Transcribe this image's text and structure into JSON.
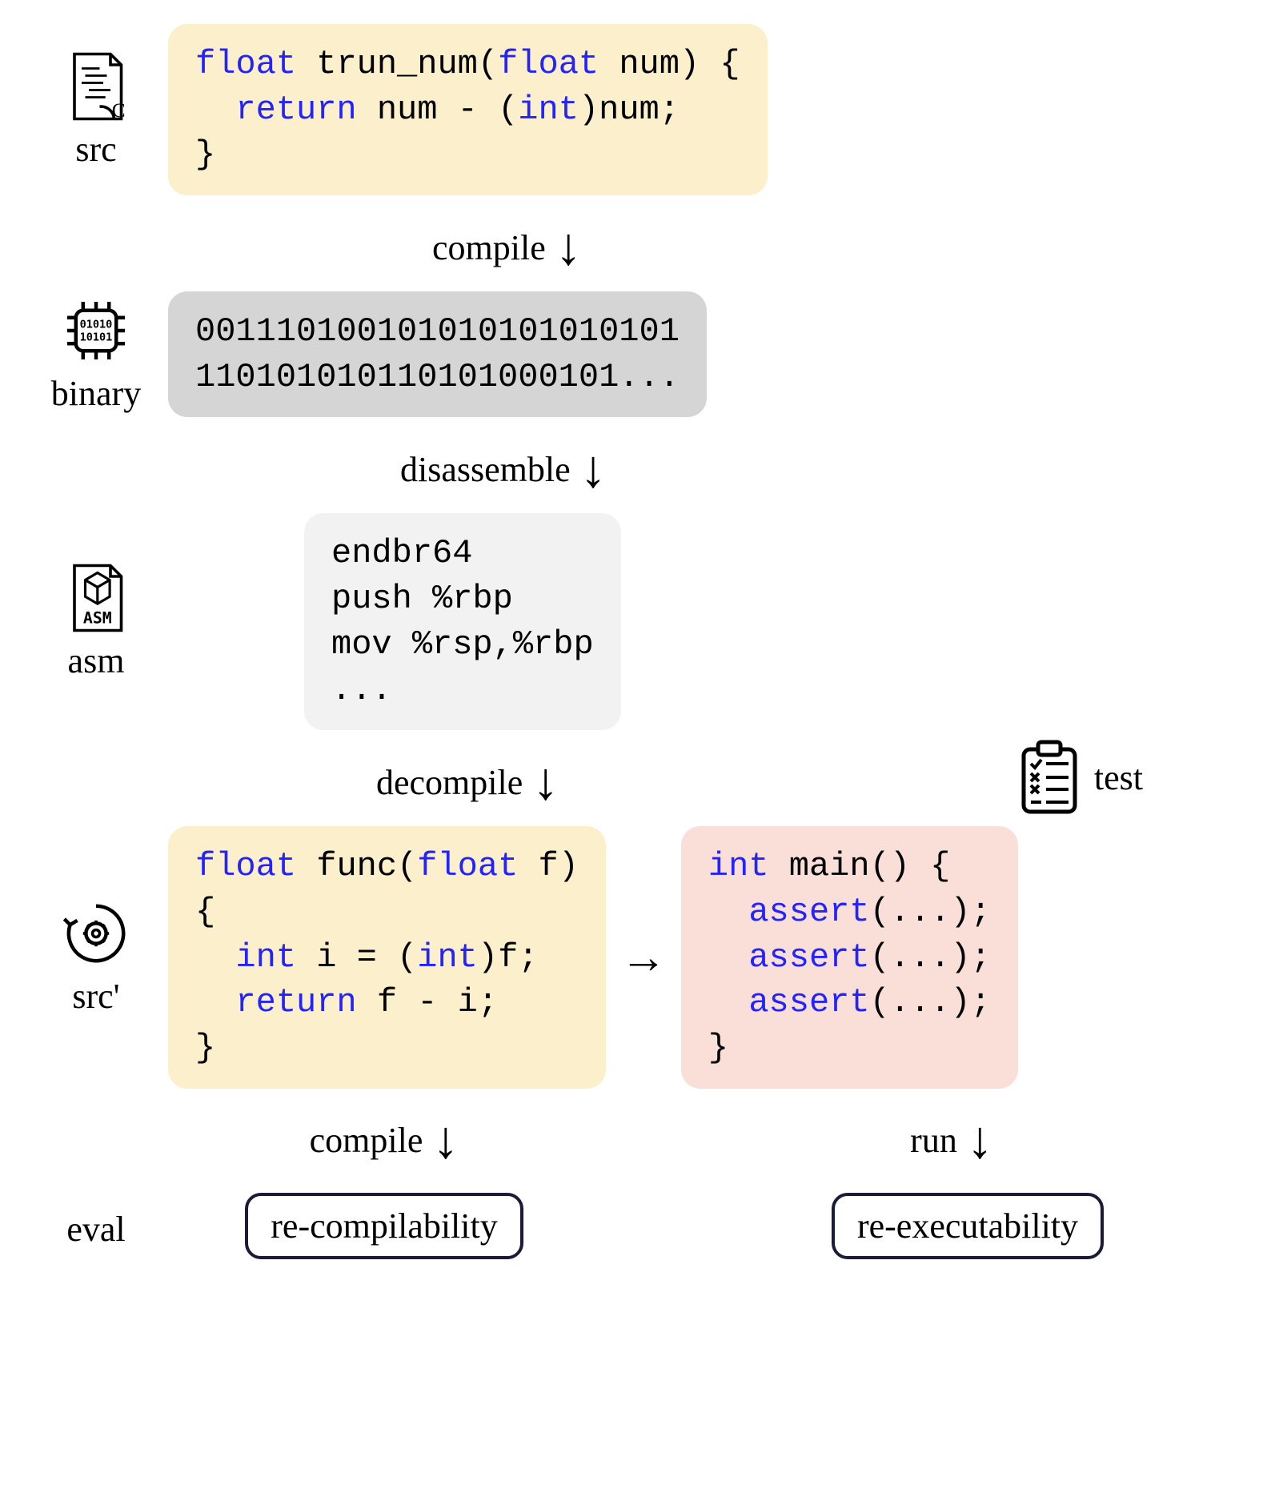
{
  "labels": {
    "src": "src",
    "binary": "binary",
    "asm": "asm",
    "srcprime": "src'",
    "eval": "eval",
    "test": "test"
  },
  "arrows": {
    "compile": "compile",
    "disassemble": "disassemble",
    "decompile": "decompile",
    "compile2": "compile",
    "run": "run"
  },
  "code": {
    "src_l1_a": "float",
    "src_l1_b": " trun_num(",
    "src_l1_c": "float",
    "src_l1_d": " num) {",
    "src_l2_a": "  return",
    "src_l2_b": " num - (",
    "src_l2_c": "int",
    "src_l2_d": ")num;",
    "src_l3": "}",
    "bin_l1": "001110100101010101010101",
    "bin_l2": "110101010110101000101...",
    "asm_l1": "endbr64",
    "asm_l2": "push %rbp",
    "asm_l3": "mov %rsp,%rbp",
    "asm_l4": "...",
    "srcp_l1_a": "float",
    "srcp_l1_b": " func(",
    "srcp_l1_c": "float",
    "srcp_l1_d": " f)",
    "srcp_l2": "{",
    "srcp_l3_a": "  int",
    "srcp_l3_b": " i = (",
    "srcp_l3_c": "int",
    "srcp_l3_d": ")f;",
    "srcp_l4_a": "  return",
    "srcp_l4_b": " f - i;",
    "srcp_l5": "}",
    "test_l1_a": "int",
    "test_l1_b": " main() {",
    "test_l2_a": "  assert",
    "test_l2_b": "(...);",
    "test_l5": "}"
  },
  "eval": {
    "recomp": "re-compilability",
    "reexec": "re-executability"
  }
}
